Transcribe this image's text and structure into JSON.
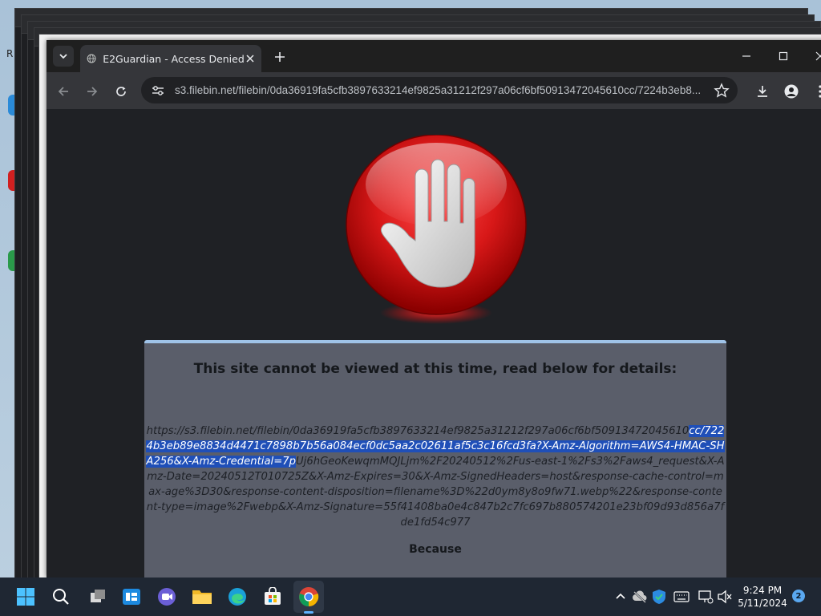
{
  "desktop": {
    "partial_label": "R"
  },
  "browser": {
    "tab": {
      "title": "E2Guardian - Access Denied"
    },
    "address": {
      "url": "s3.filebin.net/filebin/0da36919fa5cfb3897633214ef9825a31212f297a06cf6bf50913472045610cc/7224b3eb8..."
    }
  },
  "page": {
    "heading": "This site cannot be viewed at this time, read below for details:",
    "blocked_url_before": "https://s3.filebin.net/filebin/0da36919fa5cfb3897633214ef9825a31212f297a06cf6bf50913472045610",
    "blocked_url_selected": "cc/7224b3eb89e8834d4471c7898b7b56a084ecf0dc5aa2c02611af5c3c16fcd3fa?X-Amz-Algorithm=AWS4-HMAC-SHA256&X-Amz-Credential=7p",
    "blocked_url_after": "Uj6hGeoKewqmMQJLjm%2F20240512%2Fus-east-1%2Fs3%2Faws4_request&X-Amz-Date=20240512T010725Z&X-Amz-Expires=30&X-Amz-SignedHeaders=host&response-cache-control=max-age%3D30&response-content-disposition=filename%3D%22d0ym8y8o9fw71.webp%22&response-content-type=image%2Fwebp&X-Amz-Signature=55f41408ba0e4c847b2c7fc697b880574201e23bf09d93d856a7fde1fd54c977",
    "because_label": "Because"
  },
  "taskbar": {
    "time": "9:24 PM",
    "date": "5/11/2024",
    "notification_count": "2"
  },
  "colors": {
    "selection": "#1f4fb8",
    "panel": "#5a5e6a",
    "panel_border": "#9fc3e8",
    "stop_red": "#e01515"
  }
}
